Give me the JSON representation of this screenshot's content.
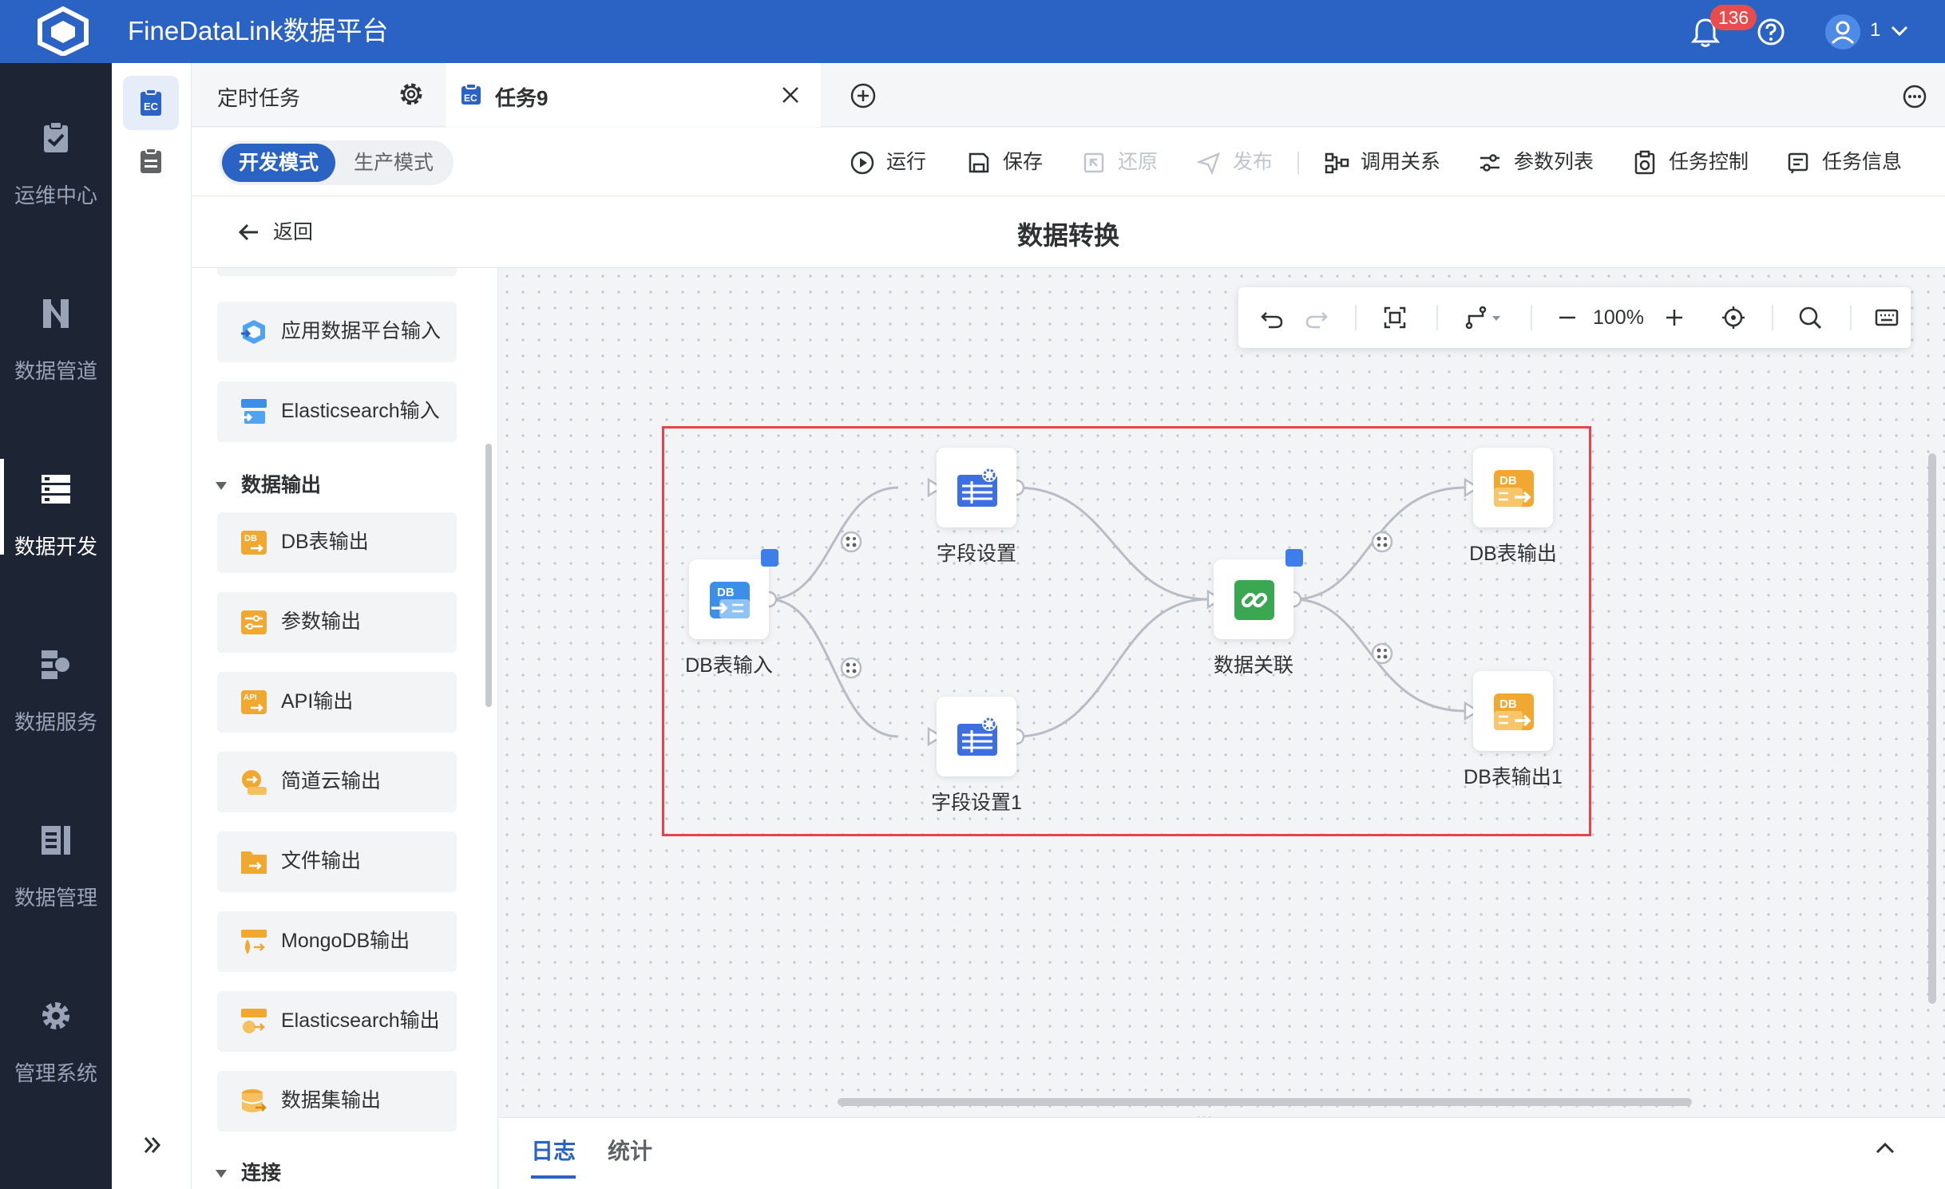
{
  "app": {
    "title": "FineDataLink数据平台",
    "notification_count": "136",
    "user_name": "1"
  },
  "leftnav": {
    "items": [
      {
        "label": "运维中心",
        "icon": "clipboard-check-icon"
      },
      {
        "label": "数据管道",
        "icon": "pipeline-icon"
      },
      {
        "label": "数据开发",
        "icon": "dev-server-icon",
        "active": true
      },
      {
        "label": "数据服务",
        "icon": "service-icon"
      },
      {
        "label": "数据管理",
        "icon": "data-manage-icon"
      },
      {
        "label": "管理系统",
        "icon": "gear-icon"
      }
    ],
    "expand_icon": "double-chevron-right-icon"
  },
  "tabs": [
    {
      "label": "定时任务",
      "icon": "gear-icon"
    },
    {
      "label": "任务9",
      "icon": "task-icon",
      "active": true
    }
  ],
  "modes": {
    "dev": "开发模式",
    "prod": "生产模式",
    "active": "开发模式"
  },
  "toolbar": {
    "run": "运行",
    "save": "保存",
    "restore": "还原",
    "publish": "发布",
    "call_relation": "调用关系",
    "param_list": "参数列表",
    "task_control": "任务控制",
    "task_info": "任务信息"
  },
  "header": {
    "back": "返回",
    "title": "数据转换"
  },
  "components": {
    "items_top": [
      {
        "label": "应用数据平台输入",
        "icon": "app-platform-input-icon"
      },
      {
        "label": "Elasticsearch输入",
        "icon": "elasticsearch-input-icon"
      }
    ],
    "group_output": "数据输出",
    "items_output": [
      {
        "label": "DB表输出",
        "icon": "db-output-icon"
      },
      {
        "label": "参数输出",
        "icon": "param-output-icon"
      },
      {
        "label": "API输出",
        "icon": "api-output-icon"
      },
      {
        "label": "简道云输出",
        "icon": "jdy-output-icon"
      },
      {
        "label": "文件输出",
        "icon": "file-output-icon"
      },
      {
        "label": "MongoDB输出",
        "icon": "mongodb-output-icon"
      },
      {
        "label": "Elasticsearch输出",
        "icon": "elasticsearch-output-icon"
      },
      {
        "label": "数据集输出",
        "icon": "dataset-output-icon"
      }
    ],
    "group_connect": "连接"
  },
  "canvas": {
    "zoom": "100%",
    "nodes": [
      {
        "id": "n1",
        "label": "DB表输入",
        "icon": "db-input-icon"
      },
      {
        "id": "n2",
        "label": "字段设置",
        "icon": "field-settings-icon"
      },
      {
        "id": "n3",
        "label": "字段设置1",
        "icon": "field-settings-icon"
      },
      {
        "id": "n4",
        "label": "数据关联",
        "icon": "data-join-icon"
      },
      {
        "id": "n5",
        "label": "DB表输出",
        "icon": "db-output-icon"
      },
      {
        "id": "n6",
        "label": "DB表输出1",
        "icon": "db-output-icon"
      }
    ],
    "edges": [
      [
        "n1",
        "n2"
      ],
      [
        "n1",
        "n3"
      ],
      [
        "n2",
        "n4"
      ],
      [
        "n3",
        "n4"
      ],
      [
        "n4",
        "n5"
      ],
      [
        "n4",
        "n6"
      ]
    ],
    "colors": {
      "selection": "#e8434a",
      "accent": "#2a63c4",
      "db_input": "#3d8ee6",
      "db_output": "#f0a830",
      "join": "#3aa853"
    }
  },
  "bottom": {
    "tab_log": "日志",
    "tab_stats": "统计"
  }
}
